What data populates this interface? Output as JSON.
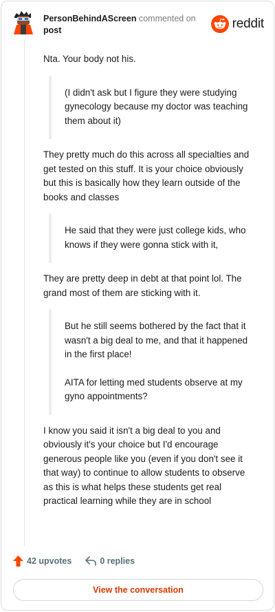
{
  "header": {
    "author": "PersonBehindAScreen",
    "action": "commented on",
    "target": "post",
    "brand": "reddit"
  },
  "comment": {
    "p1": "Nta. Your body not his.",
    "q1": "(I didn't ask but I figure they were studying gynecology because my doctor was teaching them about it)",
    "p2": "They pretty much do this across all specialties and get tested on this stuff. It is your choice obviously but this is basically how they learn outside of the books and classes",
    "q2": "He said that they were just college kids, who knows if they were gonna stick with it,",
    "p3": "They are pretty deep in debt at that point lol. The grand most of them are sticking with it.",
    "q3a": "But he still seems bothered by the fact that it wasn't a big deal to me, and that it happened in the first place!",
    "q3b": "AITA for letting med students observe at my gyno appointments?",
    "p4": "I know you said it isn't a big deal to you and obviously it's your choice but I'd encourage generous people like you (even if you don't see it that way) to continue to allow students to observe as this is what helps these students get real practical learning while they are in school"
  },
  "footer": {
    "upvotes": "42 upvotes",
    "replies": "0 replies",
    "view_button": "View the conversation"
  },
  "colors": {
    "brand_orange": "#ff4500",
    "link_orange": "#d93a00",
    "meta_gray": "#576f76"
  }
}
